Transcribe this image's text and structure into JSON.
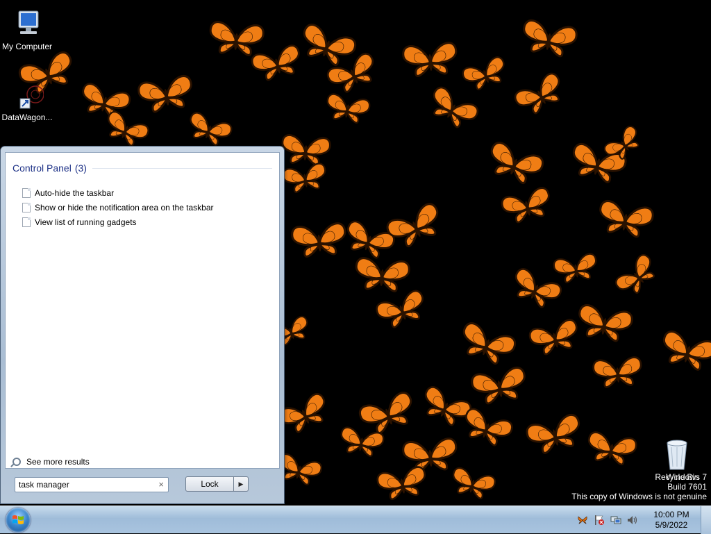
{
  "desktop": {
    "icons": [
      {
        "label": "My Computer"
      },
      {
        "label": "DataWagon..."
      },
      {
        "label": "Recycle Bin"
      }
    ],
    "watermark": {
      "line1": "Windows 7",
      "line2": "Build 7601",
      "line3": "This copy of Windows is not genuine"
    }
  },
  "start_menu": {
    "group": {
      "title": "Control Panel",
      "count": "(3)"
    },
    "results": [
      {
        "label": "Auto-hide the taskbar"
      },
      {
        "label": "Show or hide the notification area on the taskbar"
      },
      {
        "label": "View list of running gadgets"
      }
    ],
    "see_more": "See more results",
    "search": {
      "value": "task manager",
      "clear": "×"
    },
    "lock_label": "Lock",
    "power_arrow": "▶"
  },
  "taskbar": {
    "clock": {
      "time": "10:00 PM",
      "date": "5/9/2022"
    }
  },
  "colors": {
    "butterfly_orange": "#f07d14",
    "butterfly_dark": "#2a1200",
    "link_blue": "#1e3287"
  }
}
